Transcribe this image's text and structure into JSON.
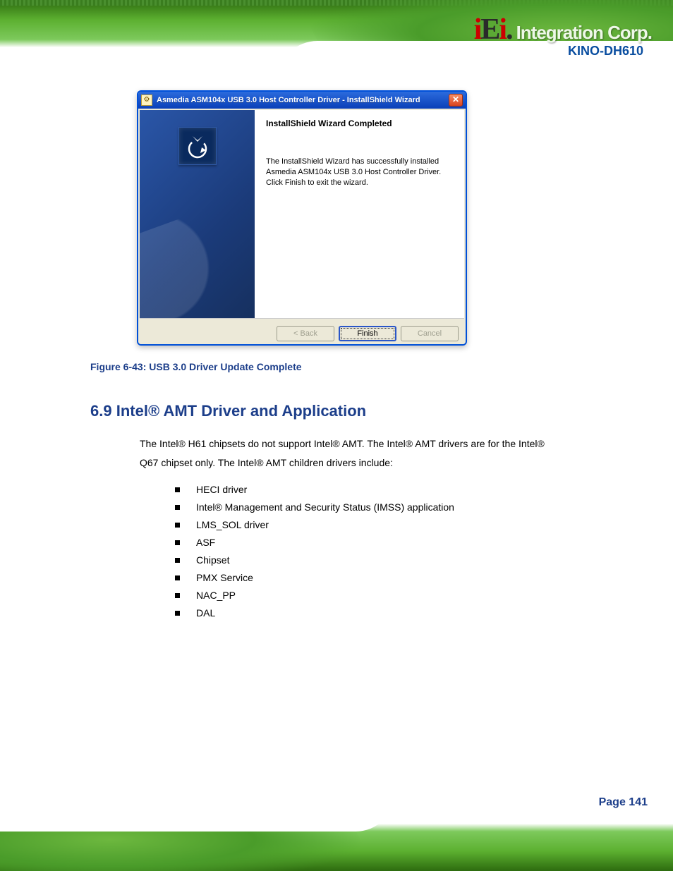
{
  "brand": {
    "logo_main": "iEi",
    "logo_sub": "Integration Corp.",
    "product": "KINO-DH610"
  },
  "dialog": {
    "title": "Asmedia ASM104x USB 3.0 Host Controller Driver - InstallShield Wizard",
    "heading": "InstallShield Wizard Completed",
    "body": "The InstallShield Wizard has successfully installed Asmedia ASM104x USB 3.0 Host Controller Driver. Click Finish to exit the wizard.",
    "buttons": {
      "back": "< Back",
      "finish": "Finish",
      "cancel": "Cancel"
    }
  },
  "figure_caption": "Figure 6-43: USB 3.0 Driver Update Complete",
  "section": {
    "number": "6.9",
    "title": "Intel® AMT Driver and Application",
    "intro": "The Intel® H61 chipsets do not support Intel® AMT. The Intel® AMT drivers are for the Intel® Q67 chipset only. The Intel® AMT children drivers include:",
    "items": [
      "HECI driver",
      "Intel® Management and Security Status (IMSS) application",
      "LMS_SOL driver",
      "ASF",
      "Chipset",
      "PMX Service",
      "NAC_PP",
      "DAL"
    ]
  },
  "page_number": "Page 141"
}
